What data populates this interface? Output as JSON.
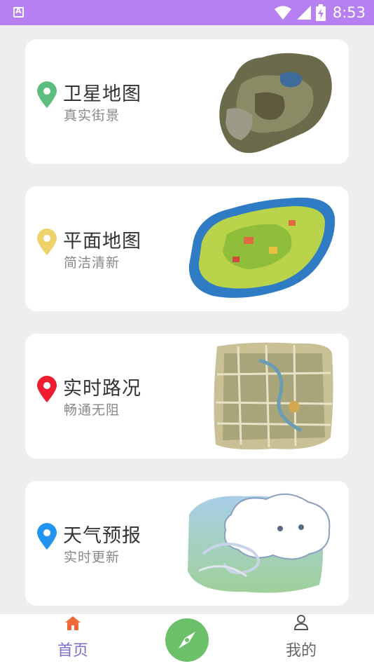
{
  "status_bar": {
    "time": "8:53",
    "icons": [
      "app-a-icon",
      "wifi-icon",
      "signal-icon",
      "battery-charging-icon"
    ],
    "background": "#b780f2"
  },
  "cards": [
    {
      "title": "卫星地图",
      "subtitle": "真实街景",
      "pin_color": "#5cbd7e",
      "art": "satellite-terrain-image"
    },
    {
      "title": "平面地图",
      "subtitle": "简洁清新",
      "pin_color": "#eed36a",
      "art": "flat-island-map-image"
    },
    {
      "title": "实时路况",
      "subtitle": "畅通无阻",
      "pin_color": "#ee1c2e",
      "art": "city-street-map-image"
    },
    {
      "title": "天气预报",
      "subtitle": "实时更新",
      "pin_color": "#2393f0",
      "art": "wind-cloud-image"
    }
  ],
  "bottom_nav": {
    "home_label": "首页",
    "mine_label": "我的",
    "active_color": "#7a6fcf",
    "home_icon_color": "#ee6a3a",
    "compass_color": "#6cc06a"
  }
}
